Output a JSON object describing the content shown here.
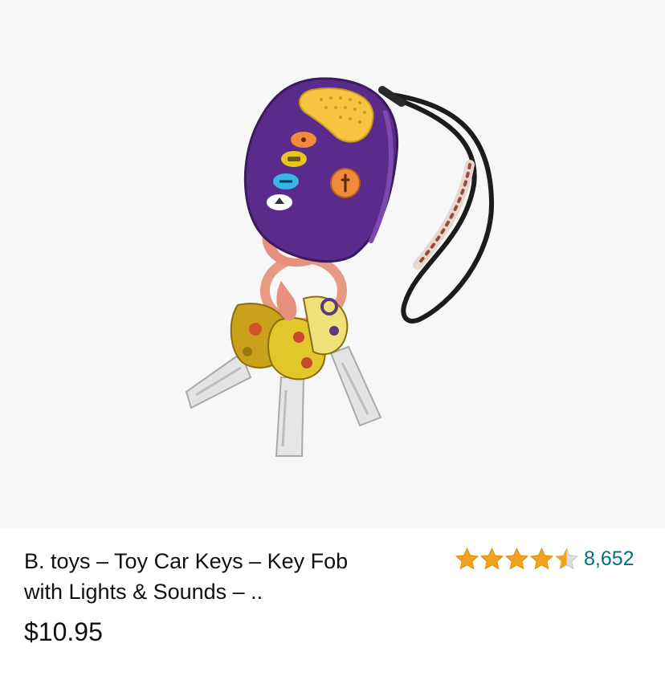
{
  "product": {
    "image_alt": "B. toys Toy Car Keys key fob with purple remote, strap and three play keys",
    "title": "B. toys – Toy Car Keys – Key Fob with Lights & Sounds – ..",
    "price": "$10.95",
    "rating": {
      "value": 4.5,
      "max": 5,
      "count": "8,652"
    }
  },
  "icons": {
    "star_full": "star-full-icon",
    "star_half": "star-half-icon"
  },
  "colors": {
    "star": "#f4a41c",
    "star_empty": "#dedede",
    "rating_link": "#007185",
    "image_bg": "#f7f7f7"
  }
}
